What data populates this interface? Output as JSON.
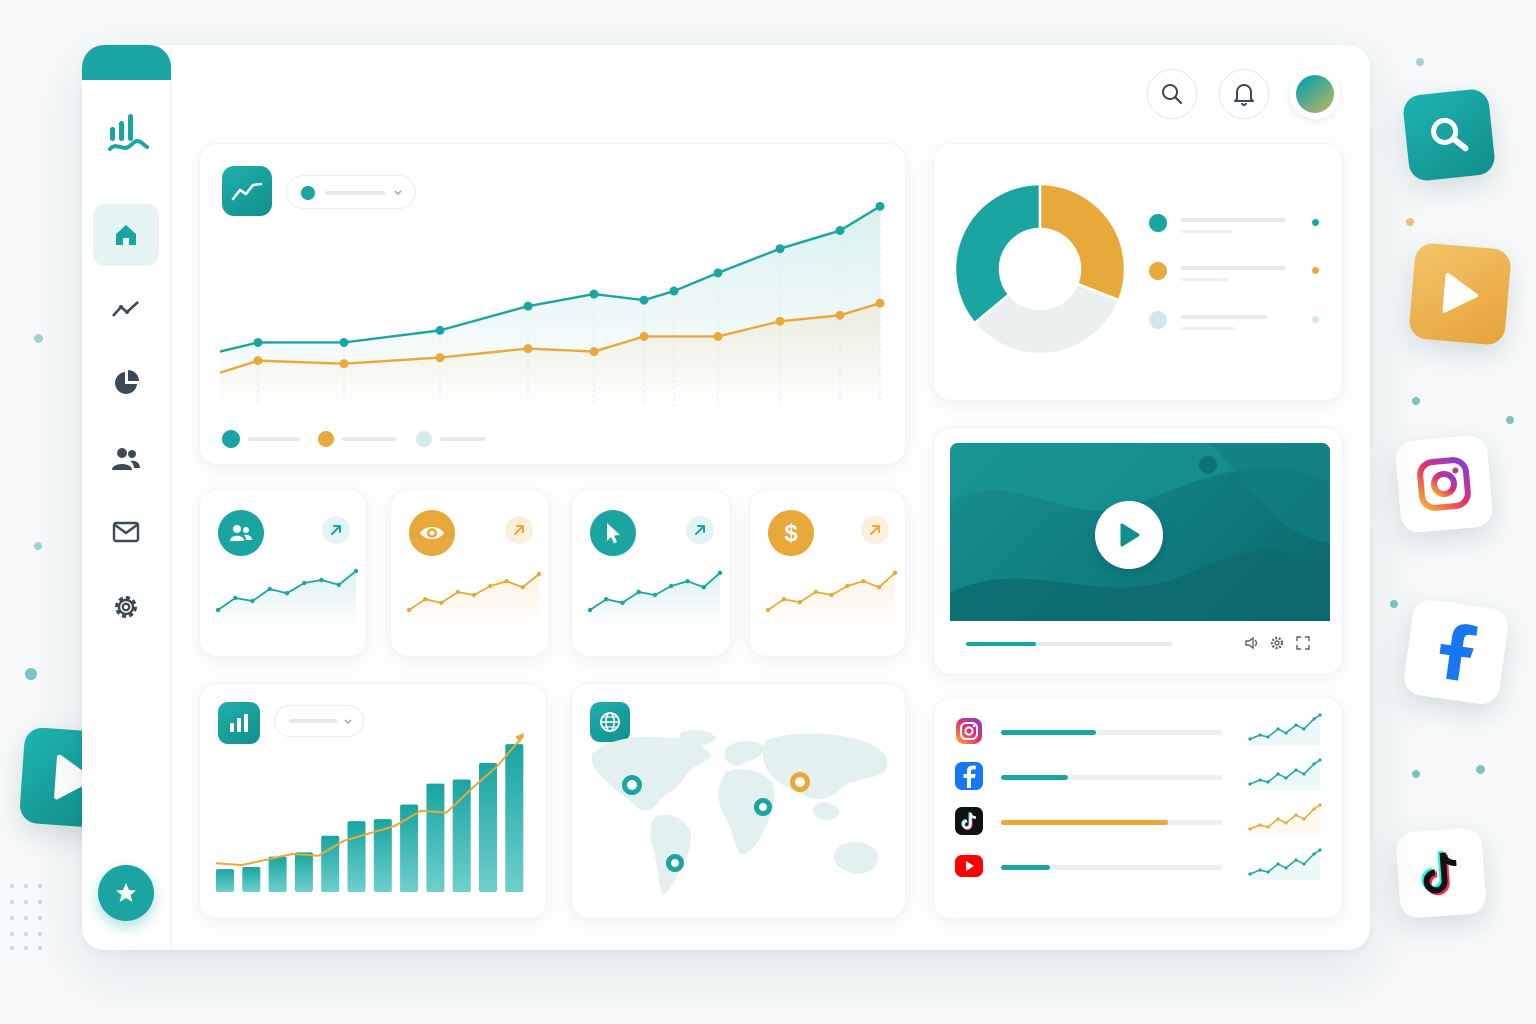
{
  "colors": {
    "teal": "#1aa5a3",
    "teal_dark": "#0f7d80",
    "gold": "#e8a93a",
    "light_teal": "#cfe9e8",
    "grey": "#e4e9ea"
  },
  "header": {
    "icons": [
      "search-icon",
      "bell-icon",
      "avatar"
    ]
  },
  "sidebar": {
    "logo": "bar-chart-logo-icon",
    "items": [
      {
        "icon": "home-icon",
        "active": true
      },
      {
        "icon": "trend-icon",
        "active": false
      },
      {
        "icon": "pie-chart-icon",
        "active": false
      },
      {
        "icon": "users-icon",
        "active": false
      },
      {
        "icon": "mail-icon",
        "active": false
      },
      {
        "icon": "settings-icon",
        "active": false
      }
    ],
    "bottom_button": "star-icon"
  },
  "kpi_cards": [
    {
      "icon": "users-icon",
      "color": "#1aa5a3",
      "trend_icon": "arrow-up-right-icon"
    },
    {
      "icon": "eye-icon",
      "color": "#e8a93a",
      "trend_icon": "arrow-up-right-icon"
    },
    {
      "icon": "cursor-icon",
      "color": "#1aa5a3",
      "trend_icon": "arrow-up-right-icon"
    },
    {
      "icon": "dollar-icon",
      "color": "#e8a93a",
      "trend_icon": "arrow-up-right-icon",
      "symbol": "$"
    }
  ],
  "video_player": {
    "progress": 0.34,
    "controls": [
      "volume-icon",
      "settings-icon",
      "fullscreen-icon"
    ]
  },
  "social_list": [
    {
      "platform": "instagram-icon",
      "progress": 0.43,
      "color": "#1aa5a3"
    },
    {
      "platform": "facebook-icon",
      "progress": 0.3,
      "color": "#1aa5a3"
    },
    {
      "platform": "tiktok-icon",
      "progress": 0.75,
      "color": "#e8a93a"
    },
    {
      "platform": "youtube-icon",
      "progress": 0.22,
      "color": "#1aa5a3"
    }
  ],
  "floating_icons": [
    "search-icon",
    "play-icon",
    "instagram-icon",
    "facebook-icon",
    "tiktok-icon",
    "play-icon"
  ],
  "chart_data": [
    {
      "type": "line",
      "series": [
        {
          "values": [
            38,
            41,
            41,
            45,
            53,
            57,
            55,
            58,
            64,
            72,
            78,
            86
          ]
        },
        {
          "values": [
            31,
            35,
            34,
            36,
            39,
            38,
            43,
            43,
            48,
            50,
            54
          ]
        }
      ],
      "ylim": [
        20,
        100
      ],
      "grid": false
    },
    {
      "type": "pie",
      "values": [
        36,
        31,
        33
      ],
      "colors": [
        "#1aa5a3",
        "#e8a93a",
        "#eceff0"
      ]
    },
    {
      "type": "bar",
      "values": [
        11,
        12,
        17,
        19,
        27,
        34,
        35,
        42,
        52,
        54,
        62,
        71
      ],
      "trend": [
        10,
        9,
        12,
        15,
        14,
        22,
        26,
        30,
        38,
        37,
        50,
        62,
        78
      ]
    },
    {
      "type": "scatter",
      "values": [
        [
          20,
          40,
          35,
          55,
          48,
          65,
          70,
          62,
          85
        ],
        [
          20,
          38,
          32,
          50,
          45,
          60,
          68,
          58,
          80
        ],
        [
          20,
          38,
          32,
          50,
          45,
          60,
          68,
          58,
          82
        ],
        [
          20,
          38,
          33,
          50,
          45,
          60,
          68,
          58,
          82
        ]
      ]
    }
  ]
}
